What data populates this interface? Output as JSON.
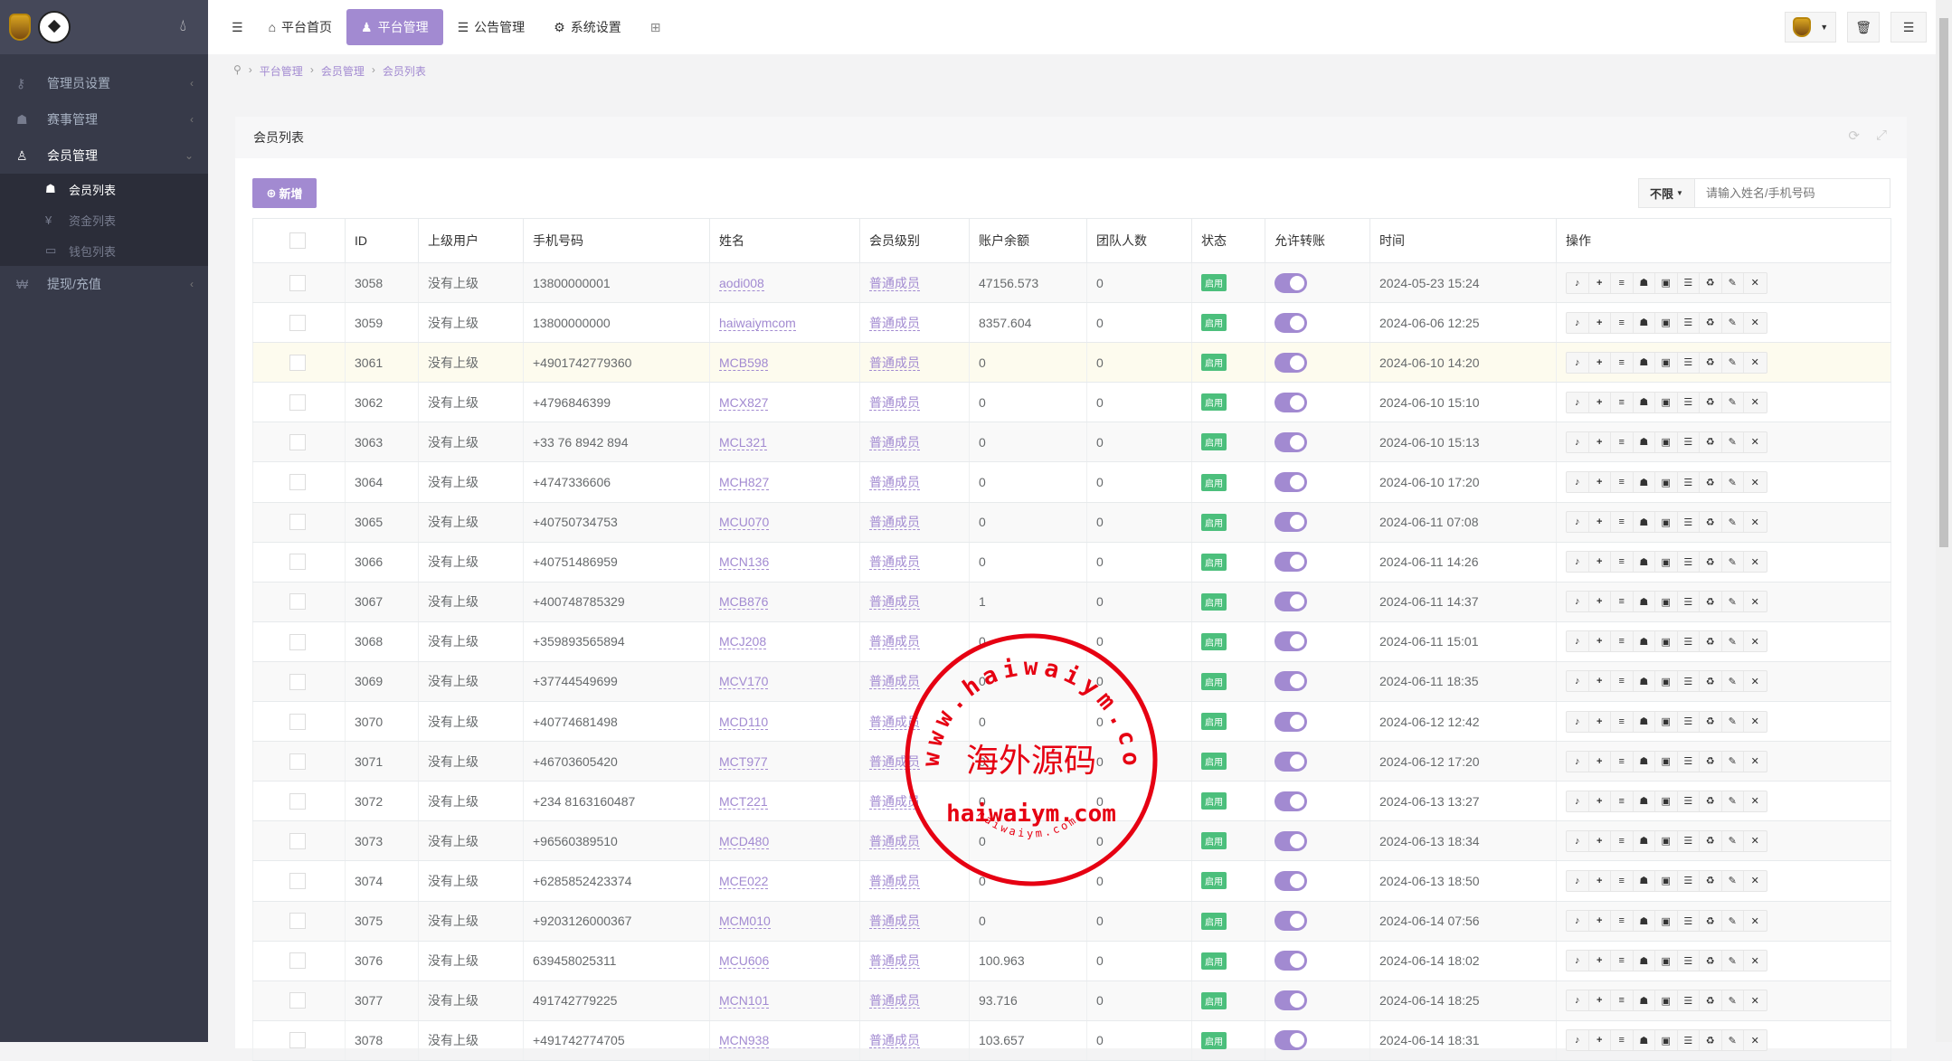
{
  "sidebar": {
    "items": [
      {
        "label": "管理员设置",
        "icon": "key-icon"
      },
      {
        "label": "赛事管理",
        "icon": "users-icon"
      },
      {
        "label": "会员管理",
        "icon": "user-icon"
      },
      {
        "label": "提现/充值",
        "icon": "won-icon"
      }
    ],
    "sub_items": [
      {
        "label": "会员列表"
      },
      {
        "label": "资金列表"
      },
      {
        "label": "钱包列表"
      }
    ]
  },
  "topbar": {
    "tabs": [
      {
        "label": "平台首页"
      },
      {
        "label": "平台管理"
      },
      {
        "label": "公告管理"
      },
      {
        "label": "系统设置"
      }
    ]
  },
  "breadcrumb": [
    "平台管理",
    "会员管理",
    "会员列表"
  ],
  "panel": {
    "title": "会员列表",
    "new_label": "新增",
    "filter": "不限",
    "search_placeholder": "请输入姓名/手机号码"
  },
  "table": {
    "headers": [
      "",
      "ID",
      "上级用户",
      "手机号码",
      "姓名",
      "会员级别",
      "账户余额",
      "团队人数",
      "状态",
      "允许转账",
      "时间",
      "操作"
    ],
    "rows": [
      [
        "3058",
        "没有上级",
        "13800000001",
        "aodi008",
        "普通成员",
        "47156.573",
        "0",
        "启用",
        "2024-05-23 15:24"
      ],
      [
        "3059",
        "没有上级",
        "13800000000",
        "haiwaiymcom",
        "普通成员",
        "8357.604",
        "0",
        "启用",
        "2024-06-06 12:25"
      ],
      [
        "3061",
        "没有上级",
        "+4901742779360",
        "MCB598",
        "普通成员",
        "0",
        "0",
        "启用",
        "2024-06-10 14:20"
      ],
      [
        "3062",
        "没有上级",
        "+4796846399",
        "MCX827",
        "普通成员",
        "0",
        "0",
        "启用",
        "2024-06-10 15:10"
      ],
      [
        "3063",
        "没有上级",
        "+33 76 8942 894",
        "MCL321",
        "普通成员",
        "0",
        "0",
        "启用",
        "2024-06-10 15:13"
      ],
      [
        "3064",
        "没有上级",
        "+4747336606",
        "MCH827",
        "普通成员",
        "0",
        "0",
        "启用",
        "2024-06-10 17:20"
      ],
      [
        "3065",
        "没有上级",
        "+40750734753",
        "MCU070",
        "普通成员",
        "0",
        "0",
        "启用",
        "2024-06-11 07:08"
      ],
      [
        "3066",
        "没有上级",
        "+40751486959",
        "MCN136",
        "普通成员",
        "0",
        "0",
        "启用",
        "2024-06-11 14:26"
      ],
      [
        "3067",
        "没有上级",
        "+400748785329",
        "MCB876",
        "普通成员",
        "1",
        "0",
        "启用",
        "2024-06-11 14:37"
      ],
      [
        "3068",
        "没有上级",
        "+359893565894",
        "MCJ208",
        "普通成员",
        "0",
        "0",
        "启用",
        "2024-06-11 15:01"
      ],
      [
        "3069",
        "没有上级",
        "+37744549699",
        "MCV170",
        "普通成员",
        "0",
        "0",
        "启用",
        "2024-06-11 18:35"
      ],
      [
        "3070",
        "没有上级",
        "+40774681498",
        "MCD110",
        "普通成员",
        "0",
        "0",
        "启用",
        "2024-06-12 12:42"
      ],
      [
        "3071",
        "没有上级",
        "+46703605420",
        "MCT977",
        "普通成员",
        "0",
        "0",
        "启用",
        "2024-06-12 17:20"
      ],
      [
        "3072",
        "没有上级",
        "+234 8163160487",
        "MCT221",
        "普通成员",
        "0",
        "0",
        "启用",
        "2024-06-13 13:27"
      ],
      [
        "3073",
        "没有上级",
        "+96560389510",
        "MCD480",
        "普通成员",
        "0",
        "0",
        "启用",
        "2024-06-13 18:34"
      ],
      [
        "3074",
        "没有上级",
        "+6285852423374",
        "MCE022",
        "普通成员",
        "0",
        "0",
        "启用",
        "2024-06-13 18:50"
      ],
      [
        "3075",
        "没有上级",
        "+9203126000367",
        "MCM010",
        "普通成员",
        "0",
        "0",
        "启用",
        "2024-06-14 07:56"
      ],
      [
        "3076",
        "没有上级",
        "639458025311",
        "MCU606",
        "普通成员",
        "100.963",
        "0",
        "启用",
        "2024-06-14 18:02"
      ],
      [
        "3077",
        "没有上级",
        "491742779225",
        "MCN101",
        "普通成员",
        "93.716",
        "0",
        "启用",
        "2024-06-14 18:25"
      ],
      [
        "3078",
        "没有上级",
        "+491742774705",
        "MCN938",
        "普通成员",
        "103.657",
        "0",
        "启用",
        "2024-06-14 18:31"
      ]
    ],
    "transfer_enabled": true,
    "actions": [
      "bell-icon",
      "plus-icon",
      "bars-icon",
      "users-icon",
      "money-icon",
      "list-icon",
      "recycle-icon",
      "pencil-icon",
      "times-icon"
    ]
  },
  "watermark": {
    "ring": "www.haiwaiym.com",
    "center": "海外源码",
    "line": "haiwaiym.com",
    "bottom": "haiwaiym.com"
  },
  "colors": {
    "accent": "#a28ad1",
    "status": "#4cbf7c",
    "sidebar": "#373a49"
  }
}
